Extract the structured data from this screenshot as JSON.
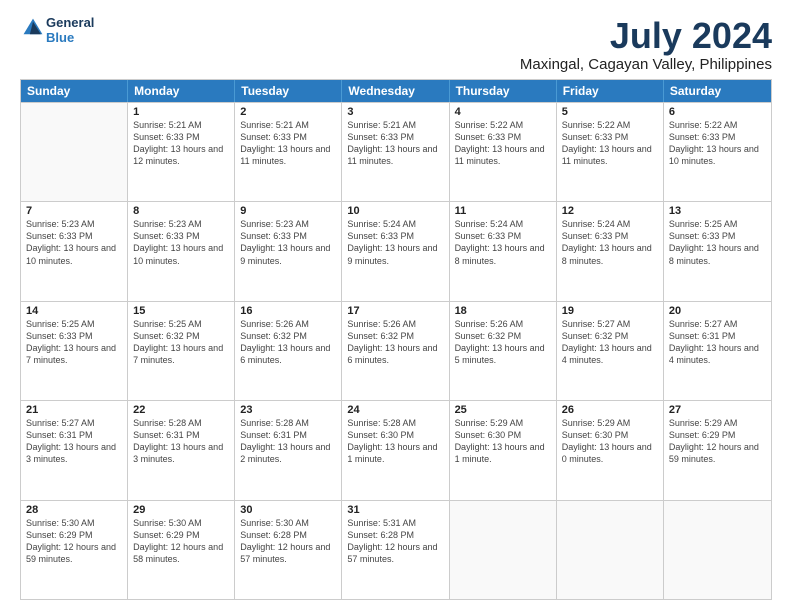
{
  "logo": {
    "line1": "General",
    "line2": "Blue"
  },
  "title": "July 2024",
  "subtitle": "Maxingal, Cagayan Valley, Philippines",
  "calendar": {
    "headers": [
      "Sunday",
      "Monday",
      "Tuesday",
      "Wednesday",
      "Thursday",
      "Friday",
      "Saturday"
    ],
    "rows": [
      [
        {
          "day": "",
          "info": ""
        },
        {
          "day": "1",
          "info": "Sunrise: 5:21 AM\nSunset: 6:33 PM\nDaylight: 13 hours\nand 12 minutes."
        },
        {
          "day": "2",
          "info": "Sunrise: 5:21 AM\nSunset: 6:33 PM\nDaylight: 13 hours\nand 11 minutes."
        },
        {
          "day": "3",
          "info": "Sunrise: 5:21 AM\nSunset: 6:33 PM\nDaylight: 13 hours\nand 11 minutes."
        },
        {
          "day": "4",
          "info": "Sunrise: 5:22 AM\nSunset: 6:33 PM\nDaylight: 13 hours\nand 11 minutes."
        },
        {
          "day": "5",
          "info": "Sunrise: 5:22 AM\nSunset: 6:33 PM\nDaylight: 13 hours\nand 11 minutes."
        },
        {
          "day": "6",
          "info": "Sunrise: 5:22 AM\nSunset: 6:33 PM\nDaylight: 13 hours\nand 10 minutes."
        }
      ],
      [
        {
          "day": "7",
          "info": "Sunrise: 5:23 AM\nSunset: 6:33 PM\nDaylight: 13 hours\nand 10 minutes."
        },
        {
          "day": "8",
          "info": "Sunrise: 5:23 AM\nSunset: 6:33 PM\nDaylight: 13 hours\nand 10 minutes."
        },
        {
          "day": "9",
          "info": "Sunrise: 5:23 AM\nSunset: 6:33 PM\nDaylight: 13 hours\nand 9 minutes."
        },
        {
          "day": "10",
          "info": "Sunrise: 5:24 AM\nSunset: 6:33 PM\nDaylight: 13 hours\nand 9 minutes."
        },
        {
          "day": "11",
          "info": "Sunrise: 5:24 AM\nSunset: 6:33 PM\nDaylight: 13 hours\nand 8 minutes."
        },
        {
          "day": "12",
          "info": "Sunrise: 5:24 AM\nSunset: 6:33 PM\nDaylight: 13 hours\nand 8 minutes."
        },
        {
          "day": "13",
          "info": "Sunrise: 5:25 AM\nSunset: 6:33 PM\nDaylight: 13 hours\nand 8 minutes."
        }
      ],
      [
        {
          "day": "14",
          "info": "Sunrise: 5:25 AM\nSunset: 6:33 PM\nDaylight: 13 hours\nand 7 minutes."
        },
        {
          "day": "15",
          "info": "Sunrise: 5:25 AM\nSunset: 6:32 PM\nDaylight: 13 hours\nand 7 minutes."
        },
        {
          "day": "16",
          "info": "Sunrise: 5:26 AM\nSunset: 6:32 PM\nDaylight: 13 hours\nand 6 minutes."
        },
        {
          "day": "17",
          "info": "Sunrise: 5:26 AM\nSunset: 6:32 PM\nDaylight: 13 hours\nand 6 minutes."
        },
        {
          "day": "18",
          "info": "Sunrise: 5:26 AM\nSunset: 6:32 PM\nDaylight: 13 hours\nand 5 minutes."
        },
        {
          "day": "19",
          "info": "Sunrise: 5:27 AM\nSunset: 6:32 PM\nDaylight: 13 hours\nand 4 minutes."
        },
        {
          "day": "20",
          "info": "Sunrise: 5:27 AM\nSunset: 6:31 PM\nDaylight: 13 hours\nand 4 minutes."
        }
      ],
      [
        {
          "day": "21",
          "info": "Sunrise: 5:27 AM\nSunset: 6:31 PM\nDaylight: 13 hours\nand 3 minutes."
        },
        {
          "day": "22",
          "info": "Sunrise: 5:28 AM\nSunset: 6:31 PM\nDaylight: 13 hours\nand 3 minutes."
        },
        {
          "day": "23",
          "info": "Sunrise: 5:28 AM\nSunset: 6:31 PM\nDaylight: 13 hours\nand 2 minutes."
        },
        {
          "day": "24",
          "info": "Sunrise: 5:28 AM\nSunset: 6:30 PM\nDaylight: 13 hours\nand 1 minute."
        },
        {
          "day": "25",
          "info": "Sunrise: 5:29 AM\nSunset: 6:30 PM\nDaylight: 13 hours\nand 1 minute."
        },
        {
          "day": "26",
          "info": "Sunrise: 5:29 AM\nSunset: 6:30 PM\nDaylight: 13 hours\nand 0 minutes."
        },
        {
          "day": "27",
          "info": "Sunrise: 5:29 AM\nSunset: 6:29 PM\nDaylight: 12 hours\nand 59 minutes."
        }
      ],
      [
        {
          "day": "28",
          "info": "Sunrise: 5:30 AM\nSunset: 6:29 PM\nDaylight: 12 hours\nand 59 minutes."
        },
        {
          "day": "29",
          "info": "Sunrise: 5:30 AM\nSunset: 6:29 PM\nDaylight: 12 hours\nand 58 minutes."
        },
        {
          "day": "30",
          "info": "Sunrise: 5:30 AM\nSunset: 6:28 PM\nDaylight: 12 hours\nand 57 minutes."
        },
        {
          "day": "31",
          "info": "Sunrise: 5:31 AM\nSunset: 6:28 PM\nDaylight: 12 hours\nand 57 minutes."
        },
        {
          "day": "",
          "info": ""
        },
        {
          "day": "",
          "info": ""
        },
        {
          "day": "",
          "info": ""
        }
      ]
    ]
  }
}
